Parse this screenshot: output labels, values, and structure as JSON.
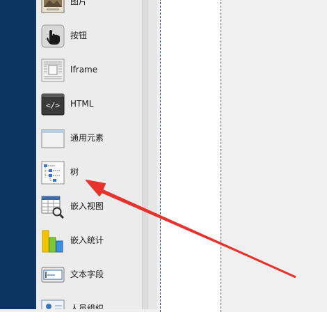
{
  "palette": {
    "items": [
      {
        "label": "图片",
        "icon": "image-icon"
      },
      {
        "label": "按钮",
        "icon": "hand-pointer-icon"
      },
      {
        "label": "Iframe",
        "icon": "iframe-icon"
      },
      {
        "label": "HTML",
        "icon": "html-code-icon"
      },
      {
        "label": "通用元素",
        "icon": "generic-element-icon"
      },
      {
        "label": "树",
        "icon": "tree-icon"
      },
      {
        "label": "嵌入视图",
        "icon": "embedded-view-icon"
      },
      {
        "label": "嵌入统计",
        "icon": "embedded-chart-icon"
      },
      {
        "label": "文本字段",
        "icon": "text-field-icon"
      },
      {
        "label": "人员组织",
        "icon": "person-org-icon"
      }
    ]
  },
  "annotation": {
    "arrow_color": "#e8322e",
    "points_to": "树"
  },
  "colors": {
    "left_strip": "#0a3560",
    "palette_bg": "#ececec",
    "canvas_bg": "#f0f0f0"
  }
}
